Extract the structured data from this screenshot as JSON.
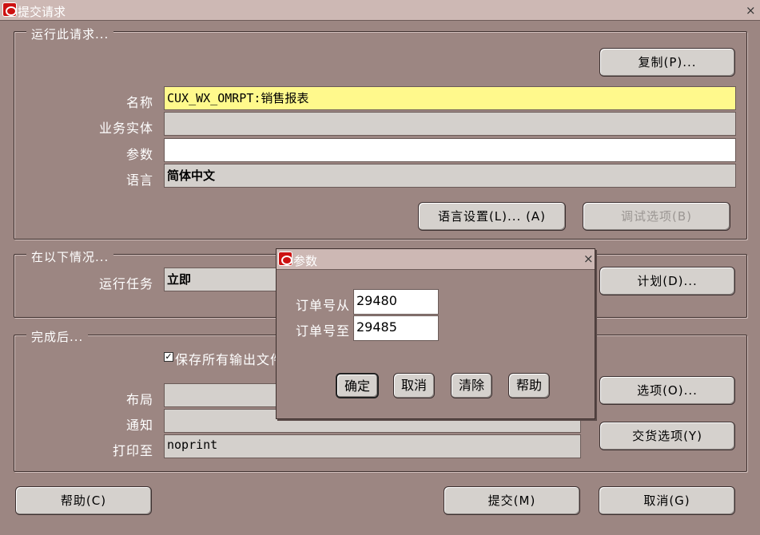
{
  "window": {
    "title": "提交请求",
    "close": "×"
  },
  "run_group": {
    "title": "运行此请求...",
    "copy_button": "复制(P)...",
    "name_label": "名称",
    "name_value": "CUX_WX_OMRPT:销售报表",
    "org_label": "业务实体",
    "org_value": "",
    "params_label": "参数",
    "params_value": "",
    "lang_label": "语言",
    "lang_value": "简体中文",
    "lang_settings_button": "语言设置(L)... (A)",
    "debug_button": "调试选项(B)"
  },
  "schedule_group": {
    "title": "在以下情况...",
    "run_task_label": "运行任务",
    "run_task_value": "立即",
    "schedule_button": "计划(D)..."
  },
  "completion_group": {
    "title": "完成后...",
    "save_output_label": "保存所有输出文件",
    "save_output_checked": true,
    "layout_label": "布局",
    "layout_value": "",
    "notify_label": "通知",
    "notify_value": "",
    "print_label": "打印至",
    "print_value": "noprint",
    "options_button": "选项(O)...",
    "delivery_button": "交货选项(Y)"
  },
  "footer": {
    "help_button": "帮助(C)",
    "submit_button": "提交(M)",
    "cancel_button": "取消(G)"
  },
  "param_dialog": {
    "title": "参数",
    "close": "×",
    "order_from_label": "订单号从",
    "order_from_value": "29480",
    "order_to_label": "订单号至",
    "order_to_value": "29485",
    "ok_button": "确定",
    "cancel_button": "取消",
    "clear_button": "清除",
    "help_button": "帮助"
  }
}
